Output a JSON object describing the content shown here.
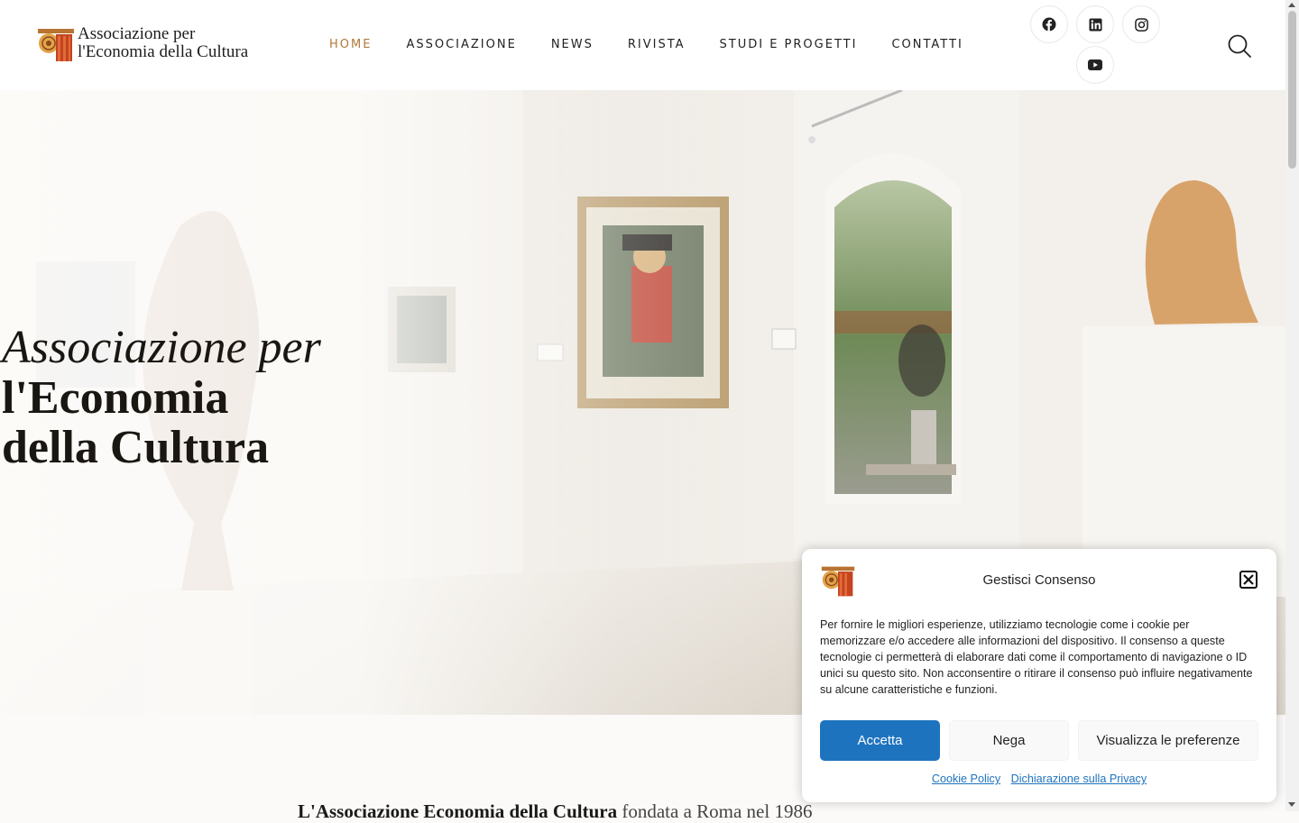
{
  "header": {
    "logo_line1": "Associazione per",
    "logo_line2": "l'Economia della Cultura",
    "nav": [
      {
        "label": "HOME"
      },
      {
        "label": "ASSOCIAZIONE"
      },
      {
        "label": "NEWS"
      },
      {
        "label": "RIVISTA"
      },
      {
        "label": "STUDI E PROGETTI"
      },
      {
        "label": "CONTATTI"
      }
    ],
    "social_icons": [
      "facebook-icon",
      "linkedin-icon",
      "instagram-icon",
      "youtube-icon"
    ],
    "active_color": "#b07a3a"
  },
  "hero": {
    "line1": "Associazione per",
    "line2": "l'Economia",
    "line3": "della Cultura"
  },
  "intro": {
    "bold": "L'Associazione Economia della Cultura",
    "rest": " fondata a Roma nel 1986"
  },
  "cookie": {
    "title": "Gestisci Consenso",
    "body": "Per fornire le migliori esperienze, utilizziamo tecnologie come i cookie per memorizzare e/o accedere alle informazioni del dispositivo. Il consenso a queste tecnologie ci permetterà di elaborare dati come il comportamento di navigazione o ID unici su questo sito. Non acconsentire o ritirare il consenso può influire negativamente su alcune caratteristiche e funzioni.",
    "accept_label": "Accetta",
    "deny_label": "Nega",
    "prefs_label": "Visualizza le preferenze",
    "cookie_policy_label": "Cookie Policy",
    "privacy_label": "Dichiarazione sulla Privacy",
    "accent_color": "#1e73be"
  }
}
